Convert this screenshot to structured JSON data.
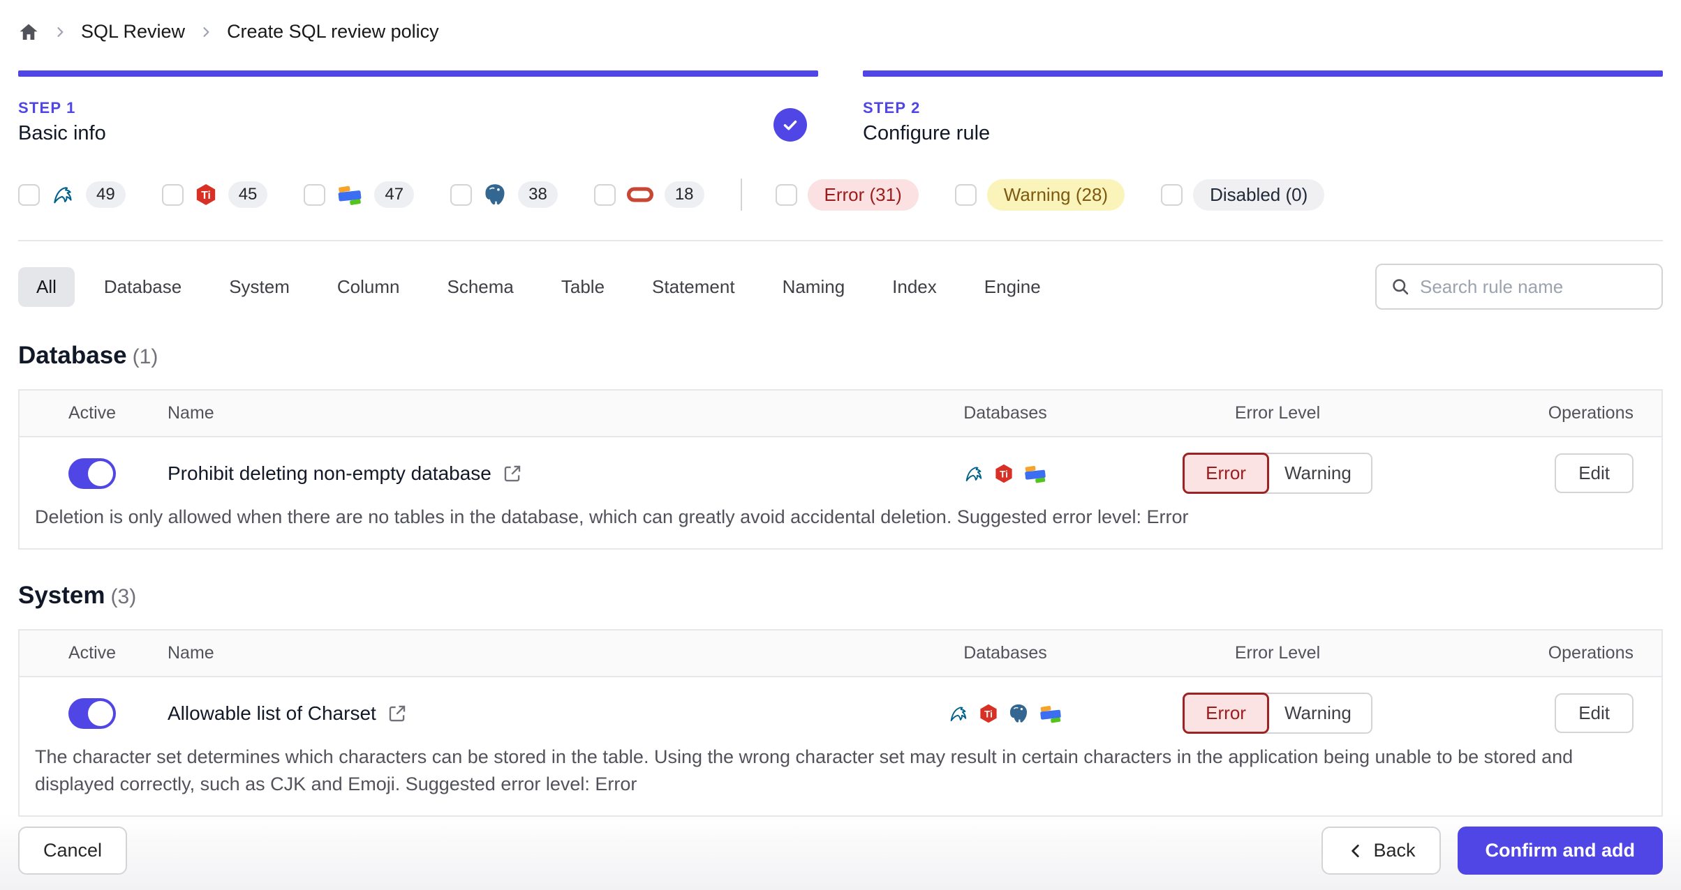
{
  "breadcrumb": {
    "items": [
      {
        "label": "SQL Review"
      },
      {
        "label": "Create SQL review policy"
      }
    ]
  },
  "steps": [
    {
      "label": "STEP 1",
      "title": "Basic info",
      "completed": true
    },
    {
      "label": "STEP 2",
      "title": "Configure rule",
      "completed": false
    }
  ],
  "filters": {
    "engines": [
      {
        "name": "MySQL",
        "icon": "mysql-icon",
        "count": "49"
      },
      {
        "name": "TiDB",
        "icon": "tidb-icon",
        "count": "45"
      },
      {
        "name": "OceanBase",
        "icon": "oceanbase-icon",
        "count": "47"
      },
      {
        "name": "PostgreSQL",
        "icon": "postgresql-icon",
        "count": "38"
      },
      {
        "name": "Oracle",
        "icon": "oracle-icon",
        "count": "18"
      }
    ],
    "levels": [
      {
        "label": "Error (31)",
        "type": "error"
      },
      {
        "label": "Warning (28)",
        "type": "warning"
      },
      {
        "label": "Disabled (0)",
        "type": "disabled"
      }
    ]
  },
  "tabs": {
    "active": "All",
    "items": [
      "All",
      "Database",
      "System",
      "Column",
      "Schema",
      "Table",
      "Statement",
      "Naming",
      "Index",
      "Engine"
    ]
  },
  "search": {
    "placeholder": "Search rule name",
    "icon": "search-icon"
  },
  "table_columns": [
    "Active",
    "Name",
    "Databases",
    "Error Level",
    "Operations"
  ],
  "labels": {
    "error": "Error",
    "warning": "Warning",
    "edit": "Edit"
  },
  "sections": [
    {
      "title": "Database",
      "count": "(1)",
      "rows": [
        {
          "active": true,
          "name": "Prohibit deleting non-empty database",
          "databases": [
            "MySQL",
            "TiDB",
            "OceanBase"
          ],
          "selected_level": "Error",
          "description": "Deletion is only allowed when there are no tables in the database, which can greatly avoid accidental deletion. Suggested error level: Error"
        }
      ]
    },
    {
      "title": "System",
      "count": "(3)",
      "rows": [
        {
          "active": true,
          "name": "Allowable list of Charset",
          "databases": [
            "MySQL",
            "TiDB",
            "PostgreSQL",
            "OceanBase"
          ],
          "selected_level": "Error",
          "description": "The character set determines which characters can be stored in the table. Using the wrong character set may result in certain characters in the application being unable to be stored and displayed correctly, such as CJK and Emoji. Suggested error level: Error"
        }
      ]
    }
  ],
  "footer": {
    "cancel": "Cancel",
    "back": "Back",
    "confirm": "Confirm and add"
  },
  "colors": {
    "accent": "#4f46e5",
    "error_bg": "#fbe3e3",
    "error_text": "#9b1c1c",
    "warning_bg": "#fbf4ba",
    "warning_text": "#7d5a12",
    "disabled_bg": "#f0f0f2",
    "border": "#e5e7eb"
  }
}
